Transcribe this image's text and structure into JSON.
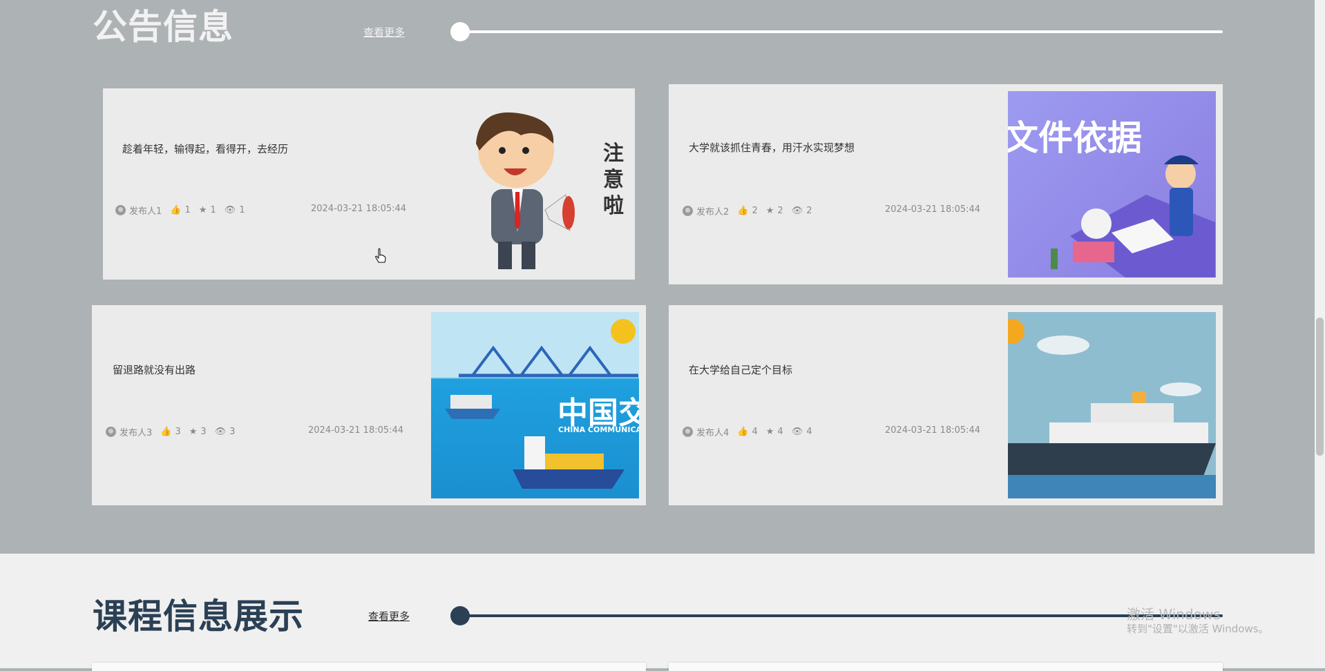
{
  "notice": {
    "title": "公告信息",
    "more": "查看更多",
    "cards": [
      {
        "title": "趁着年轻，输得起，看得开，去经历",
        "author": "发布人1",
        "likes": "1",
        "stars": "1",
        "views": "1",
        "date": "2024-03-21 18:05:44",
        "image": "announcement-cartoon"
      },
      {
        "title": "大学就该抓住青春，用汗水实现梦想",
        "author": "发布人2",
        "likes": "2",
        "stars": "2",
        "views": "2",
        "date": "2024-03-21 18:05:44",
        "image": "document-basis-police",
        "image_text": "文件依据"
      },
      {
        "title": "留退路就没有出路",
        "author": "发布人3",
        "likes": "3",
        "stars": "3",
        "views": "3",
        "date": "2024-03-21 18:05:44",
        "image": "china-communications-harbor",
        "image_text": "中国交",
        "image_subtext": "CHINA COMMUNICATIONS"
      },
      {
        "title": "在大学给自己定个目标",
        "author": "发布人4",
        "likes": "4",
        "stars": "4",
        "views": "4",
        "date": "2024-03-21 18:05:44",
        "image": "cruise-ship"
      }
    ],
    "illustration_text": "注意啦"
  },
  "course": {
    "title": "课程信息展示",
    "more": "查看更多"
  },
  "watermark": {
    "line1": "激活 Windows",
    "line2": "转到\"设置\"以激活 Windows。"
  },
  "colors": {
    "notice_bg": "#adb2b4",
    "course_bg": "#f0f0f0",
    "notice_accent": "#ffffff",
    "course_accent": "#2b4055"
  }
}
